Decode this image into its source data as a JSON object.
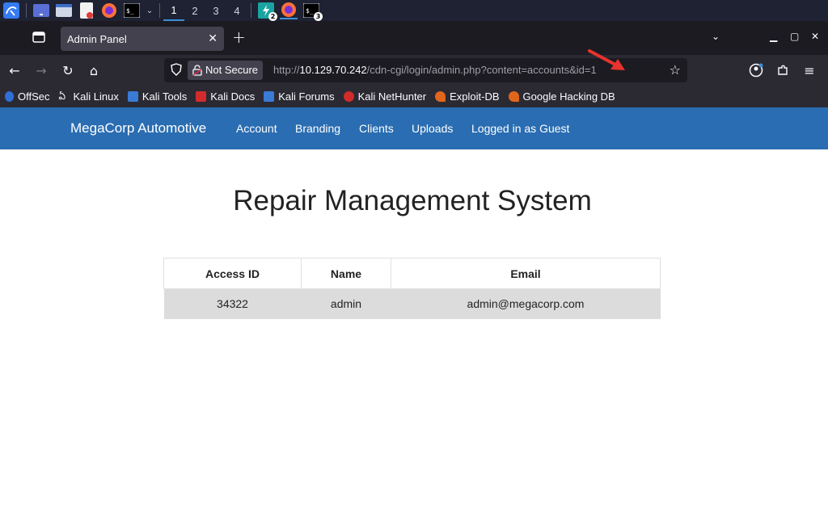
{
  "taskbar": {
    "workspaces": [
      "1",
      "2",
      "3",
      "4"
    ],
    "badges": [
      "2",
      "3"
    ]
  },
  "browser": {
    "tab_title": "Admin Panel",
    "not_secure_label": "Not Secure",
    "url_scheme": "http://",
    "url_host": "10.129.70.242",
    "url_path": "/cdn-cgi/login/admin.php?content=accounts&id=1",
    "bookmarks": [
      {
        "label": "OffSec",
        "color": "#2f6fd6"
      },
      {
        "label": "Kali Linux",
        "color": "#1c1b22"
      },
      {
        "label": "Kali Tools",
        "color": "#3a7bd5"
      },
      {
        "label": "Kali Docs",
        "color": "#d22b2b"
      },
      {
        "label": "Kali Forums",
        "color": "#3a7bd5"
      },
      {
        "label": "Kali NetHunter",
        "color": "#d22b2b"
      },
      {
        "label": "Exploit-DB",
        "color": "#e0661c"
      },
      {
        "label": "Google Hacking DB",
        "color": "#e0661c"
      }
    ]
  },
  "site": {
    "brand": "MegaCorp Automotive",
    "nav": [
      "Account",
      "Branding",
      "Clients",
      "Uploads",
      "Logged in as Guest"
    ],
    "title": "Repair Management System",
    "table": {
      "headers": [
        "Access ID",
        "Name",
        "Email"
      ],
      "rows": [
        [
          "34322",
          "admin",
          "admin@megacorp.com"
        ]
      ]
    }
  },
  "colors": {
    "site_nav": "#2a6db2",
    "annotation_arrow": "#e8332e"
  }
}
